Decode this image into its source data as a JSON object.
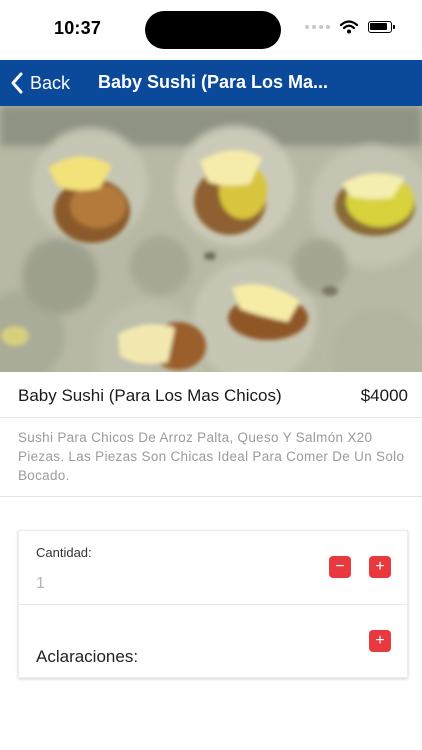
{
  "status_bar": {
    "time": "10:37"
  },
  "nav": {
    "back_label": "Back",
    "title": "Baby Sushi (Para Los Ma..."
  },
  "product": {
    "name": "Baby Sushi (Para Los Mas Chicos)",
    "price": "$4000",
    "description": "Sushi Para Chicos De Arroz Palta, Queso Y Salmón X20 Piezas. Las Piezas Son Chicas Ideal Para Comer De Un Solo Bocado."
  },
  "form": {
    "quantity_label": "Cantidad:",
    "quantity_value": "1",
    "decrement_symbol": "−",
    "increment_symbol": "+",
    "notes_label": "Aclaraciones:",
    "add_note_symbol": "+"
  },
  "icons": {
    "back": "chevron-left-icon",
    "signal": "cellular-signal-icon",
    "wifi": "wifi-icon",
    "battery": "battery-icon"
  },
  "colors": {
    "nav_background": "#0b4a9a",
    "button_red": "#e8393f",
    "description_text": "#9b9b9b"
  }
}
